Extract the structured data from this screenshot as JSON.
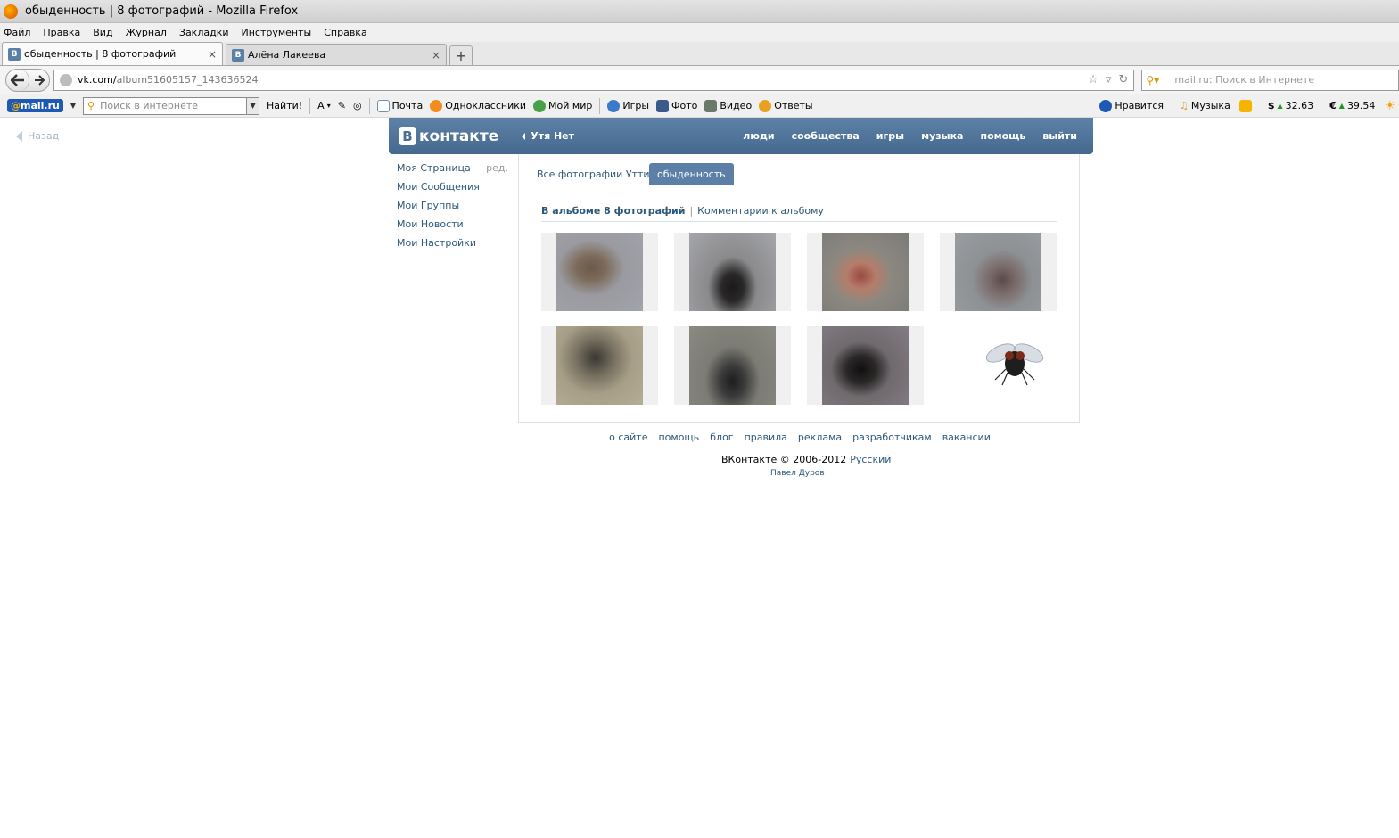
{
  "window": {
    "title": "обыденность | 8 фотографий - Mozilla Firefox"
  },
  "menu": [
    "Файл",
    "Правка",
    "Вид",
    "Журнал",
    "Закладки",
    "Инструменты",
    "Справка"
  ],
  "tabs": [
    {
      "label": "обыденность | 8 фотографий",
      "close": "×"
    },
    {
      "label": "Алёна Лакеева",
      "close": "×"
    }
  ],
  "newtab_label": "+",
  "nav": {
    "url_host": "vk.com/",
    "url_path": "album51605157_143636524",
    "search_placeholder": "mail.ru: Поиск в Интернете"
  },
  "mailbar": {
    "logo_at": "@",
    "logo_text": "mail.ru",
    "search_placeholder": "Поиск в интернете",
    "find_label": "Найти!",
    "items": [
      "Почта",
      "Одноклассники",
      "Мой мир",
      "Игры",
      "Фото",
      "Видео",
      "Ответы"
    ],
    "like_label": "Нравится",
    "music_label": "Музыка",
    "usd_symbol": "$",
    "usd": "32.63",
    "eur_symbol": "€",
    "eur": "39.54"
  },
  "page": {
    "back_label": "Назад",
    "vk": {
      "logo_letter": "В",
      "logo_text": "контакте",
      "user": "Утя Нет",
      "nav": [
        "люди",
        "сообщества",
        "игры",
        "музыка",
        "помощь",
        "выйти"
      ]
    },
    "left_menu": [
      {
        "label": "Моя Страница",
        "extra": "ред."
      },
      {
        "label": "Мои Сообщения"
      },
      {
        "label": "Мои Группы"
      },
      {
        "label": "Мои Новости"
      },
      {
        "label": "Мои Настройки"
      }
    ],
    "content_tabs": [
      "Все фотографии Утти",
      "обыденность"
    ],
    "album_count": "В альбоме 8 фотографий",
    "album_divider": "|",
    "album_comments": "Комментарии к альбому",
    "footer_links": [
      "о сайте",
      "помощь",
      "блог",
      "правила",
      "реклама",
      "разработчикам",
      "вакансии"
    ],
    "copyright": "ВКонтакте © 2006-2012",
    "language": "Русский",
    "author": "Павел Дуров"
  }
}
